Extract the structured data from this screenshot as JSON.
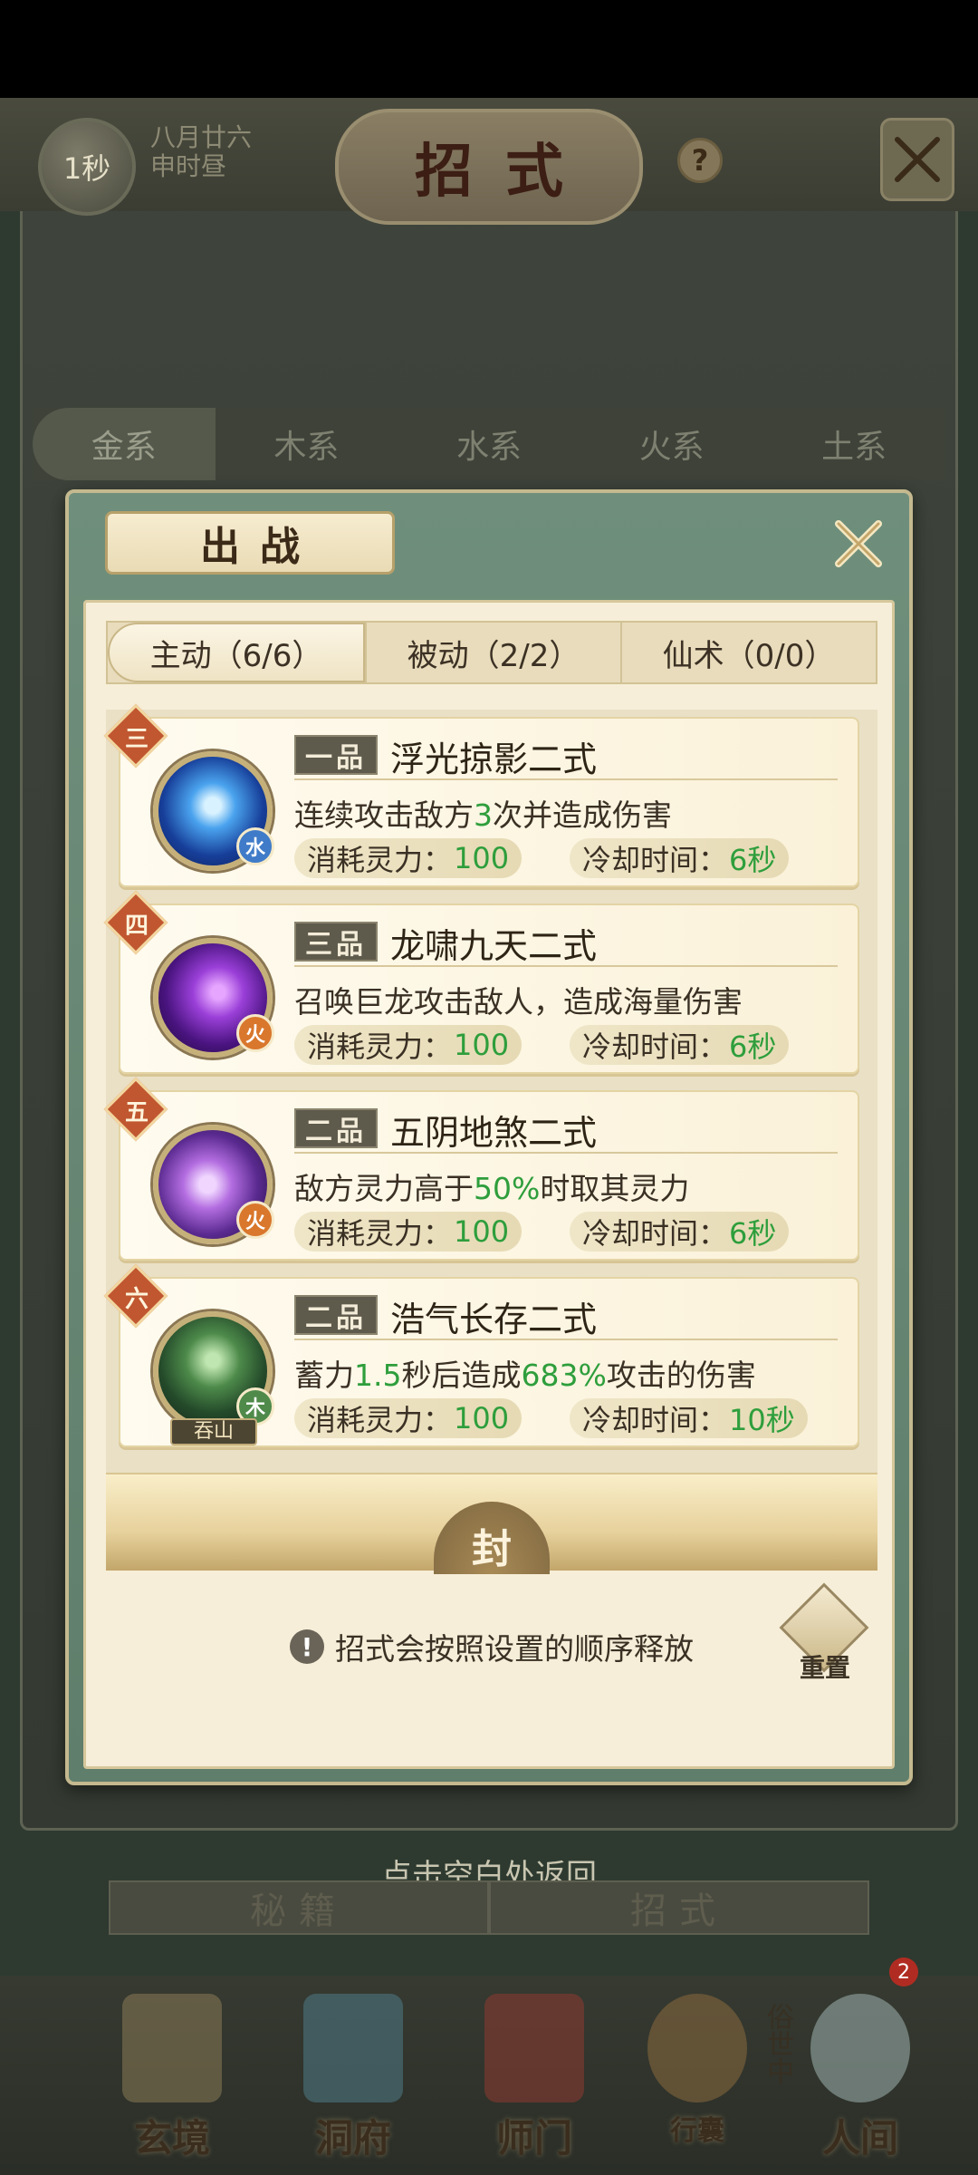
{
  "top_bar": {
    "timer": "1秒",
    "date_line1": "八月廿六",
    "date_line2": "申时昼",
    "title": "招式",
    "help_glyph": "?"
  },
  "element_tabs": [
    "金系",
    "木系",
    "水系",
    "火系",
    "土系"
  ],
  "dialog": {
    "title": "出战",
    "tabs": [
      {
        "label": "主动（6/6）",
        "selected": true
      },
      {
        "label": "被动（2/2）",
        "selected": false
      },
      {
        "label": "仙术（0/0）",
        "selected": false
      }
    ],
    "skills": [
      {
        "order": "三",
        "rank": "一品",
        "name": "浮光掠影二式",
        "desc_parts": [
          "连续攻击敌方",
          "3",
          "次并造成伤害"
        ],
        "element": "水",
        "element_color": "#3f7bc8",
        "cost_label": "消耗灵力：",
        "cost": "100",
        "cooldown_label": "冷却时间：",
        "cooldown": "6秒",
        "icon": "blue-light-burst-icon"
      },
      {
        "order": "四",
        "rank": "三品",
        "name": "龙啸九天二式",
        "desc_parts": [
          "召唤巨龙攻击敌人，造成海量伤害"
        ],
        "element": "火",
        "element_color": "#d9772c",
        "cost_label": "消耗灵力：",
        "cost": "100",
        "cooldown_label": "冷却时间：",
        "cooldown": "6秒",
        "icon": "purple-dragon-icon"
      },
      {
        "order": "五",
        "rank": "二品",
        "name": "五阴地煞二式",
        "desc_parts": [
          "敌方灵力高于",
          "50%",
          "时取其灵力"
        ],
        "element": "火",
        "element_color": "#d9772c",
        "cost_label": "消耗灵力：",
        "cost": "100",
        "cooldown_label": "冷却时间：",
        "cooldown": "6秒",
        "icon": "purple-vortex-icon"
      },
      {
        "order": "六",
        "rank": "二品",
        "name": "浩气长存二式",
        "desc_parts": [
          "蓄力",
          "1.5",
          "秒后造成",
          "683%",
          "攻击的伤害"
        ],
        "element": "木",
        "element_color": "#4f8a4a",
        "name_tag": "吞山",
        "cost_label": "消耗灵力：",
        "cost": "100",
        "cooldown_label": "冷却时间：",
        "cooldown": "10秒",
        "icon": "green-swordsman-icon"
      }
    ],
    "seal_label": "封",
    "hint": "招式会按照设置的顺序释放",
    "reset_label": "重置"
  },
  "return_hint": "点击空白处返回",
  "bottom_tabs": [
    "秘籍",
    "招式"
  ],
  "bottom_nav": [
    {
      "label": "玄境"
    },
    {
      "label": "洞府"
    },
    {
      "label": "师门"
    },
    {
      "label": "行囊"
    },
    {
      "label": "人间",
      "badge": "2",
      "side_label": "俗世中"
    }
  ]
}
